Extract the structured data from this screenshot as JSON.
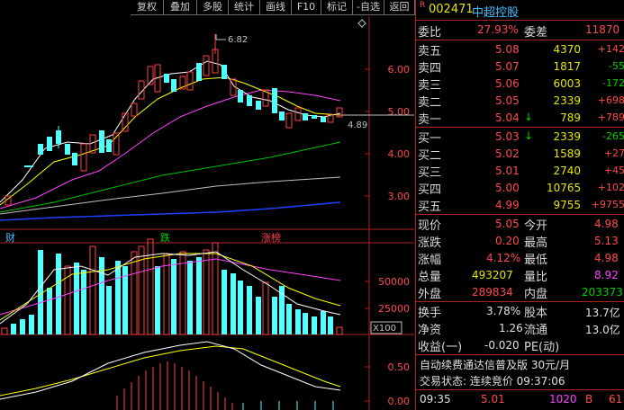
{
  "toolbar": {
    "items": [
      "复权",
      "叠加",
      "多股",
      "统计",
      "画线",
      "F10",
      "标记",
      "-自选",
      "返回"
    ]
  },
  "chart": {
    "price_ticks": [
      "6.00",
      "5.00",
      "4.00",
      "3.00"
    ],
    "high_label": "6.82",
    "current_label": "4.89",
    "markers": [
      "财",
      "跌",
      "涨榜"
    ],
    "volume_ticks": [
      "50000",
      "25000"
    ],
    "volume_unit": "X100",
    "macd_ticks": [
      "0.50",
      "0.00"
    ],
    "colors": {
      "up": "#ff4040",
      "down": "#54ffff",
      "ma5": "#ffffff",
      "ma10": "#ffff00",
      "ma20": "#ff40ff",
      "ma60": "#00c000",
      "ma120": "#c0c0c0",
      "ma250": "#2040ff"
    }
  },
  "quote": {
    "code_prefix": "R",
    "code": "002471",
    "name": "中超控股",
    "ratio_label": "委比",
    "ratio_value": "27.93%",
    "diff_label": "委差",
    "diff_value": "11870",
    "asks": [
      {
        "label": "卖五",
        "price": "5.08",
        "vol": "4370",
        "chg": "+142"
      },
      {
        "label": "卖四",
        "price": "5.07",
        "vol": "1817",
        "chg": "-55"
      },
      {
        "label": "卖三",
        "price": "5.06",
        "vol": "6003",
        "chg": "-172"
      },
      {
        "label": "卖二",
        "price": "5.05",
        "vol": "2339",
        "chg": "+698"
      },
      {
        "label": "卖一",
        "price": "5.04",
        "vol": "789",
        "chg": "+789"
      }
    ],
    "bids": [
      {
        "label": "买一",
        "price": "5.03",
        "vol": "2339",
        "chg": "-265"
      },
      {
        "label": "买二",
        "price": "5.02",
        "vol": "1589",
        "chg": "+27"
      },
      {
        "label": "买三",
        "price": "5.01",
        "vol": "2740",
        "chg": "+45"
      },
      {
        "label": "买四",
        "price": "5.00",
        "vol": "10765",
        "chg": "+102"
      },
      {
        "label": "买五",
        "price": "4.99",
        "vol": "9755",
        "chg": "+9755"
      }
    ],
    "stats": [
      {
        "l1": "现价",
        "v1": "5.05",
        "l2": "今开",
        "v2": "4.98"
      },
      {
        "l1": "涨跌",
        "v1": "0.20",
        "l2": "最高",
        "v2": "5.13"
      },
      {
        "l1": "涨幅",
        "v1": "4.12%",
        "l2": "最低",
        "v2": "4.98"
      },
      {
        "l1": "总量",
        "v1": "493207",
        "l2": "量比",
        "v2": "8.92"
      },
      {
        "l1": "外盘",
        "v1": "289834",
        "l2": "内盘",
        "v2": "203373"
      }
    ],
    "fund": [
      {
        "l1": "换手",
        "v1": "3.78%",
        "l2": "股本",
        "v2": "13.7亿"
      },
      {
        "l1": "净资",
        "v1": "1.26",
        "l2": "流通",
        "v2": "13.0亿"
      },
      {
        "l1": "收益(一)",
        "v1": "-0.020",
        "l2": "PE(动)",
        "v2": ""
      }
    ],
    "ad": "自动续费通达信普及版 30元/月",
    "status": "交易状态: 连续竞价 09:37:06",
    "tick": {
      "time": "09:35",
      "price": "5.01",
      "vol": "1020",
      "side": "B",
      "count": "61"
    }
  }
}
